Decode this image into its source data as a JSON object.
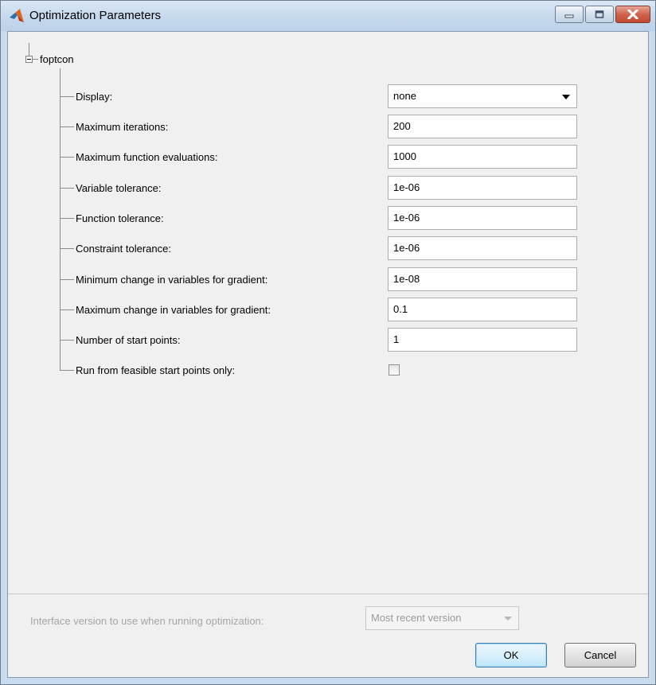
{
  "window": {
    "title": "Optimization Parameters",
    "icon": "matlab-logo-icon",
    "accent_color": "#c9dcee"
  },
  "tree": {
    "root_label": "foptcon",
    "rows": [
      {
        "label": "Display:",
        "type": "select",
        "value": "none"
      },
      {
        "label": "Maximum iterations:",
        "type": "text",
        "value": "200"
      },
      {
        "label": "Maximum function evaluations:",
        "type": "text",
        "value": "1000"
      },
      {
        "label": "Variable tolerance:",
        "type": "text",
        "value": "1e-06"
      },
      {
        "label": "Function tolerance:",
        "type": "text",
        "value": "1e-06"
      },
      {
        "label": "Constraint tolerance:",
        "type": "text",
        "value": "1e-06"
      },
      {
        "label": "Minimum change in variables for gradient:",
        "type": "text",
        "value": "1e-08"
      },
      {
        "label": "Maximum change in variables for gradient:",
        "type": "text",
        "value": "0.1"
      },
      {
        "label": "Number of start points:",
        "type": "text",
        "value": "1"
      },
      {
        "label": "Run from feasible start points only:",
        "type": "checkbox",
        "checked": false
      }
    ]
  },
  "footer": {
    "interface_label": "Interface version to use when running optimization:",
    "interface_value": "Most recent version",
    "ok_label": "OK",
    "cancel_label": "Cancel"
  }
}
